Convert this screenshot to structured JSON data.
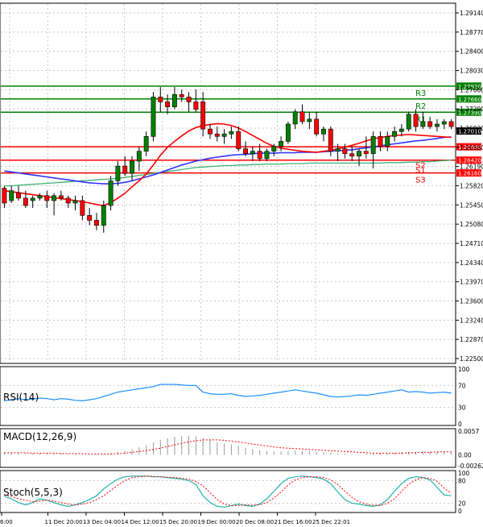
{
  "chart_data": {
    "type": "candlestick",
    "main": {
      "y_ticks": [
        "1.29140",
        "1.28770",
        "1.28400",
        "1.28030",
        "1.27660",
        "1.27290",
        "1.26930",
        "1.26560",
        "1.26190",
        "1.25820",
        "1.25450",
        "1.25080",
        "1.24710",
        "1.24340",
        "1.23970",
        "1.23600",
        "1.23240",
        "1.22870",
        "1.22500"
      ],
      "ylim": [
        1.2235,
        1.2955
      ],
      "current_price": "1.27010",
      "levels": [
        {
          "name": "R3",
          "value": 1.2792,
          "label": "1.27920",
          "color": "#008000"
        },
        {
          "name": "R2",
          "value": 1.2766,
          "label": "1.27660",
          "color": "#008000"
        },
        {
          "name": "R1",
          "value": 1.2739,
          "label": "1.27390",
          "color": "#008000"
        },
        {
          "name": "",
          "value": 1.2669,
          "label": "1.26690",
          "color": "#ff0000"
        },
        {
          "name": "S1",
          "value": 1.2642,
          "label": "1.26420",
          "color": "#ff0000"
        },
        {
          "name": "S2",
          "value": 1.2642,
          "label": "",
          "color": "#ff0000"
        },
        {
          "name": "S3",
          "value": 1.2616,
          "label": "1.26160",
          "color": "#ff0000"
        }
      ],
      "candles": [
        [
          1.2585,
          1.259,
          1.2545,
          1.2555
        ],
        [
          1.256,
          1.259,
          1.2555,
          1.258
        ],
        [
          1.2575,
          1.259,
          1.256,
          1.2565
        ],
        [
          1.2565,
          1.258,
          1.2545,
          1.255
        ],
        [
          1.256,
          1.257,
          1.2545,
          1.2565
        ],
        [
          1.2565,
          1.2575,
          1.256,
          1.257
        ],
        [
          1.257,
          1.258,
          1.2545,
          1.256
        ],
        [
          1.256,
          1.2575,
          1.253,
          1.257
        ],
        [
          1.257,
          1.258,
          1.256,
          1.2565
        ],
        [
          1.2565,
          1.257,
          1.2545,
          1.2555
        ],
        [
          1.2555,
          1.257,
          1.254,
          1.256
        ],
        [
          1.256,
          1.257,
          1.252,
          1.253
        ],
        [
          1.253,
          1.2545,
          1.251,
          1.252
        ],
        [
          1.252,
          1.2535,
          1.25,
          1.251
        ],
        [
          1.251,
          1.256,
          1.2495,
          1.255
        ],
        [
          1.255,
          1.261,
          1.254,
          1.26
        ],
        [
          1.26,
          1.264,
          1.259,
          1.263
        ],
        [
          1.263,
          1.265,
          1.261,
          1.2615
        ],
        [
          1.2615,
          1.265,
          1.26,
          1.264
        ],
        [
          1.264,
          1.267,
          1.262,
          1.266
        ],
        [
          1.266,
          1.27,
          1.265,
          1.269
        ],
        [
          1.269,
          1.278,
          1.268,
          1.277
        ],
        [
          1.277,
          1.279,
          1.274,
          1.276
        ],
        [
          1.276,
          1.2775,
          1.2735,
          1.275
        ],
        [
          1.275,
          1.279,
          1.2745,
          1.2775
        ],
        [
          1.2775,
          1.2785,
          1.276,
          1.277
        ],
        [
          1.277,
          1.278,
          1.274,
          1.276
        ],
        [
          1.276,
          1.2785,
          1.274,
          1.2745
        ],
        [
          1.276,
          1.278,
          1.269,
          1.2705
        ],
        [
          1.2705,
          1.2715,
          1.2685,
          1.2695
        ],
        [
          1.2695,
          1.271,
          1.268,
          1.269
        ],
        [
          1.269,
          1.2705,
          1.2675,
          1.2695
        ],
        [
          1.2695,
          1.271,
          1.2685,
          1.27
        ],
        [
          1.27,
          1.271,
          1.266,
          1.2665
        ],
        [
          1.2665,
          1.268,
          1.265,
          1.2655
        ],
        [
          1.2655,
          1.267,
          1.264,
          1.266
        ],
        [
          1.266,
          1.2675,
          1.264,
          1.2645
        ],
        [
          1.2645,
          1.2665,
          1.264,
          1.266
        ],
        [
          1.266,
          1.2675,
          1.265,
          1.267
        ],
        [
          1.267,
          1.269,
          1.266,
          1.268
        ],
        [
          1.268,
          1.272,
          1.2675,
          1.2715
        ],
        [
          1.2715,
          1.2745,
          1.2705,
          1.274
        ],
        [
          1.274,
          1.2755,
          1.2715,
          1.272
        ],
        [
          1.272,
          1.274,
          1.2705,
          1.2725
        ],
        [
          1.2725,
          1.274,
          1.269,
          1.2695
        ],
        [
          1.2695,
          1.271,
          1.268,
          1.2705
        ],
        [
          1.2705,
          1.271,
          1.265,
          1.266
        ],
        [
          1.266,
          1.2675,
          1.264,
          1.2665
        ],
        [
          1.2665,
          1.2675,
          1.2645,
          1.2655
        ],
        [
          1.2655,
          1.267,
          1.264,
          1.265
        ],
        [
          1.265,
          1.2665,
          1.263,
          1.266
        ],
        [
          1.266,
          1.269,
          1.2645,
          1.2655
        ],
        [
          1.2655,
          1.27,
          1.2625,
          1.269
        ],
        [
          1.269,
          1.27,
          1.266,
          1.267
        ],
        [
          1.267,
          1.27,
          1.266,
          1.269
        ],
        [
          1.269,
          1.271,
          1.268,
          1.27
        ],
        [
          1.27,
          1.2715,
          1.269,
          1.2705
        ],
        [
          1.2705,
          1.274,
          1.27,
          1.2735
        ],
        [
          1.2735,
          1.2745,
          1.27,
          1.271
        ],
        [
          1.271,
          1.274,
          1.2705,
          1.272
        ],
        [
          1.272,
          1.273,
          1.2705,
          1.271
        ],
        [
          1.271,
          1.2725,
          1.27,
          1.2715
        ],
        [
          1.2715,
          1.2725,
          1.2705,
          1.272
        ],
        [
          1.272,
          1.2725,
          1.2705,
          1.271
        ]
      ],
      "ma_red": [
        1.258,
        1.2578,
        1.2576,
        1.2574,
        1.2572,
        1.257,
        1.2568,
        1.2566,
        1.2564,
        1.2562,
        1.256,
        1.2558,
        1.2555,
        1.2552,
        1.255,
        1.2556,
        1.2565,
        1.2575,
        1.2588,
        1.26,
        1.2614,
        1.2632,
        1.2652,
        1.2668,
        1.268,
        1.2691,
        1.2701,
        1.2708,
        1.2712,
        1.2714,
        1.2716,
        1.2715,
        1.2712,
        1.2707,
        1.27,
        1.2692,
        1.2684,
        1.2676,
        1.267,
        1.2666,
        1.2664,
        1.2662,
        1.266,
        1.2659,
        1.2658,
        1.266,
        1.2662,
        1.2665,
        1.2668,
        1.2672,
        1.2676,
        1.2681,
        1.2685,
        1.2688,
        1.269,
        1.2692,
        1.2693,
        1.2694,
        1.2693,
        1.2692,
        1.2691,
        1.269,
        1.2689,
        1.2688
      ],
      "ma_blue": [
        1.262,
        1.2618,
        1.2616,
        1.2614,
        1.2612,
        1.261,
        1.2608,
        1.2606,
        1.2604,
        1.2602,
        1.26,
        1.2598,
        1.2596,
        1.2595,
        1.2594,
        1.2594,
        1.2595,
        1.2597,
        1.26,
        1.2604,
        1.2608,
        1.2612,
        1.2617,
        1.2622,
        1.2627,
        1.2632,
        1.2636,
        1.264,
        1.2643,
        1.2646,
        1.2648,
        1.265,
        1.2652,
        1.2653,
        1.2654,
        1.2655,
        1.2656,
        1.2656,
        1.2656,
        1.2657,
        1.2657,
        1.2657,
        1.2658,
        1.2658,
        1.2658,
        1.2659,
        1.266,
        1.2661,
        1.2662,
        1.2663,
        1.2665,
        1.2667,
        1.2669,
        1.2671,
        1.2673,
        1.2675,
        1.2677,
        1.2679,
        1.2681,
        1.2682,
        1.2684,
        1.2686,
        1.2688,
        1.2689
      ],
      "ma_green": [
        1.259,
        1.259,
        1.2591,
        1.2592,
        1.2593,
        1.2594,
        1.2595,
        1.2596,
        1.2597,
        1.2598,
        1.2599,
        1.26,
        1.2601,
        1.2602,
        1.2603,
        1.2604,
        1.2605,
        1.2607,
        1.2609,
        1.2611,
        1.2613,
        1.2615,
        1.2617,
        1.2619,
        1.2621,
        1.2623,
        1.2625,
        1.2627,
        1.2628,
        1.2629,
        1.263,
        1.2631,
        1.2631,
        1.2632,
        1.2632,
        1.2633,
        1.2633,
        1.2634,
        1.2634,
        1.2634,
        1.2635,
        1.2635,
        1.2635,
        1.2636,
        1.2636,
        1.2636,
        1.2636,
        1.2636,
        1.2636,
        1.2636,
        1.2636,
        1.2636,
        1.2636,
        1.2636,
        1.2637,
        1.2637,
        1.2637,
        1.2638,
        1.2638,
        1.2639,
        1.2639,
        1.264,
        1.2641,
        1.2642
      ]
    },
    "rsi": {
      "label": "RSI(14)",
      "ticks": [
        "100",
        "70",
        "30",
        "0"
      ],
      "ylim": [
        0,
        100
      ],
      "values": [
        42,
        44,
        46,
        44,
        45,
        47,
        46,
        44,
        46,
        45,
        43,
        42,
        44,
        46,
        50,
        54,
        58,
        60,
        62,
        64,
        66,
        68,
        72,
        72,
        72,
        71,
        70,
        70,
        58,
        55,
        54,
        54,
        55,
        52,
        50,
        51,
        52,
        54,
        56,
        58,
        60,
        62,
        60,
        58,
        56,
        53,
        50,
        49,
        50,
        51,
        53,
        52,
        54,
        56,
        58,
        60,
        62,
        58,
        59,
        58,
        56,
        57,
        58,
        56
      ]
    },
    "macd": {
      "label": "MACD(12,26,9)",
      "ticks": [
        "0.0057",
        "0.00",
        "-0.00262"
      ],
      "ylim": [
        -0.00262,
        0.0057
      ],
      "histogram": [
        0.0006,
        0.0005,
        0.0005,
        0.0004,
        0.0004,
        0.0004,
        0.0003,
        0.0003,
        0.0003,
        0.0002,
        0.0002,
        0.0001,
        0.0001,
        0.0001,
        0.0002,
        0.0004,
        0.0007,
        0.001,
        0.0014,
        0.0018,
        0.0023,
        0.003,
        0.0036,
        0.004,
        0.0043,
        0.0045,
        0.0046,
        0.0045,
        0.004,
        0.0035,
        0.003,
        0.0027,
        0.0025,
        0.0021,
        0.0017,
        0.0014,
        0.0011,
        0.0009,
        0.0008,
        0.0008,
        0.0009,
        0.001,
        0.001,
        0.0009,
        0.0008,
        0.0006,
        0.0005,
        0.0004,
        0.0003,
        0.0002,
        0.0002,
        0.0002,
        0.0003,
        0.0003,
        0.0004,
        0.0005,
        0.0006,
        0.0007,
        0.0007,
        0.0008,
        0.0008,
        0.0008,
        0.0008,
        0.0008
      ],
      "signal": [
        0.0005,
        0.0005,
        0.0005,
        0.0005,
        0.0004,
        0.0004,
        0.0004,
        0.0004,
        0.0003,
        0.0003,
        0.0003,
        0.0003,
        0.0002,
        0.0002,
        0.0002,
        0.0002,
        0.0003,
        0.0004,
        0.0006,
        0.0008,
        0.001,
        0.0013,
        0.0016,
        0.002,
        0.0024,
        0.0028,
        0.0031,
        0.0034,
        0.0036,
        0.0036,
        0.0036,
        0.0035,
        0.0033,
        0.0031,
        0.0029,
        0.0026,
        0.0024,
        0.0021,
        0.0019,
        0.0017,
        0.0016,
        0.0015,
        0.0014,
        0.0013,
        0.0012,
        0.0011,
        0.001,
        0.0009,
        0.0008,
        0.0007,
        0.0006,
        0.0005,
        0.0004,
        0.0004,
        0.0004,
        0.0004,
        0.0004,
        0.0005,
        0.0005,
        0.0006,
        0.0006,
        0.0007,
        0.0007,
        0.0007
      ]
    },
    "stoch": {
      "label": "Stoch(5,5,3)",
      "ticks": [
        "100",
        "80",
        "20",
        "0"
      ],
      "ylim": [
        0,
        100
      ],
      "k": [
        38,
        32,
        22,
        16,
        22,
        32,
        28,
        22,
        16,
        12,
        16,
        22,
        30,
        40,
        58,
        72,
        84,
        90,
        92,
        92,
        92,
        90,
        90,
        88,
        86,
        84,
        80,
        70,
        40,
        22,
        12,
        10,
        14,
        18,
        14,
        12,
        18,
        32,
        52,
        72,
        86,
        90,
        92,
        90,
        88,
        84,
        72,
        50,
        30,
        20,
        18,
        14,
        12,
        16,
        30,
        52,
        72,
        86,
        90,
        88,
        82,
        62,
        42,
        40
      ],
      "d": [
        42,
        38,
        32,
        28,
        24,
        26,
        28,
        26,
        22,
        18,
        16,
        18,
        22,
        30,
        40,
        54,
        68,
        80,
        88,
        90,
        92,
        91,
        90,
        89,
        88,
        86,
        84,
        78,
        66,
        48,
        30,
        18,
        14,
        14,
        16,
        15,
        16,
        22,
        34,
        50,
        68,
        82,
        88,
        90,
        90,
        88,
        82,
        70,
        52,
        36,
        24,
        18,
        15,
        14,
        20,
        32,
        52,
        70,
        82,
        88,
        86,
        78,
        60,
        46
      ]
    },
    "x_labels": [
      "6:00",
      "11 Dec 20:00",
      "13 Dec 04:00",
      "14 Dec 12:00",
      "15 Dec 20:00",
      "19 Dec 00:00",
      "20 Dec 08:00",
      "21 Dec 16:00",
      "25 Dec 22:01"
    ]
  }
}
